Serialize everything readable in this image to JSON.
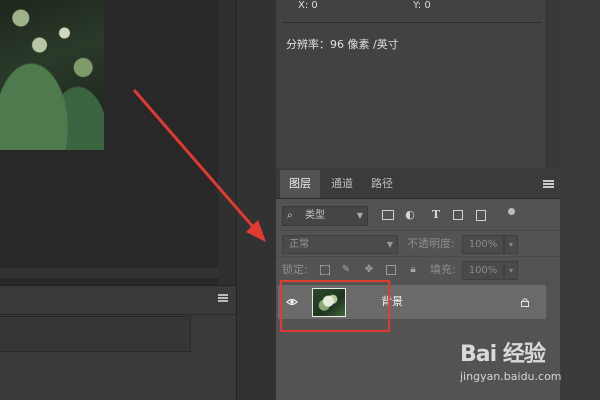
{
  "info_panel": {
    "x_readout": "X: 0",
    "y_readout": "Y: 0",
    "resolution": "分辨率：96 像素 /英寸"
  },
  "layers_panel": {
    "tabs": [
      {
        "label": "图层",
        "active": true
      },
      {
        "label": "通道",
        "active": false
      },
      {
        "label": "路径",
        "active": false
      }
    ],
    "filter": {
      "kind_label": "类型"
    },
    "blend_mode": "正常",
    "opacity_label": "不透明度:",
    "opacity_value": "100%",
    "lock_label": "锁定:",
    "fill_label": "填充:",
    "fill_value": "100%",
    "layers": [
      {
        "name": "背景",
        "visible": true,
        "locked": true
      }
    ]
  },
  "watermark": {
    "logo_text": "Bai 经验",
    "url": "jingyan.baidu.com"
  },
  "colors": {
    "highlight": "#e03a33",
    "panel_bg": "#535353",
    "selected_layer": "#6a6a6a"
  }
}
